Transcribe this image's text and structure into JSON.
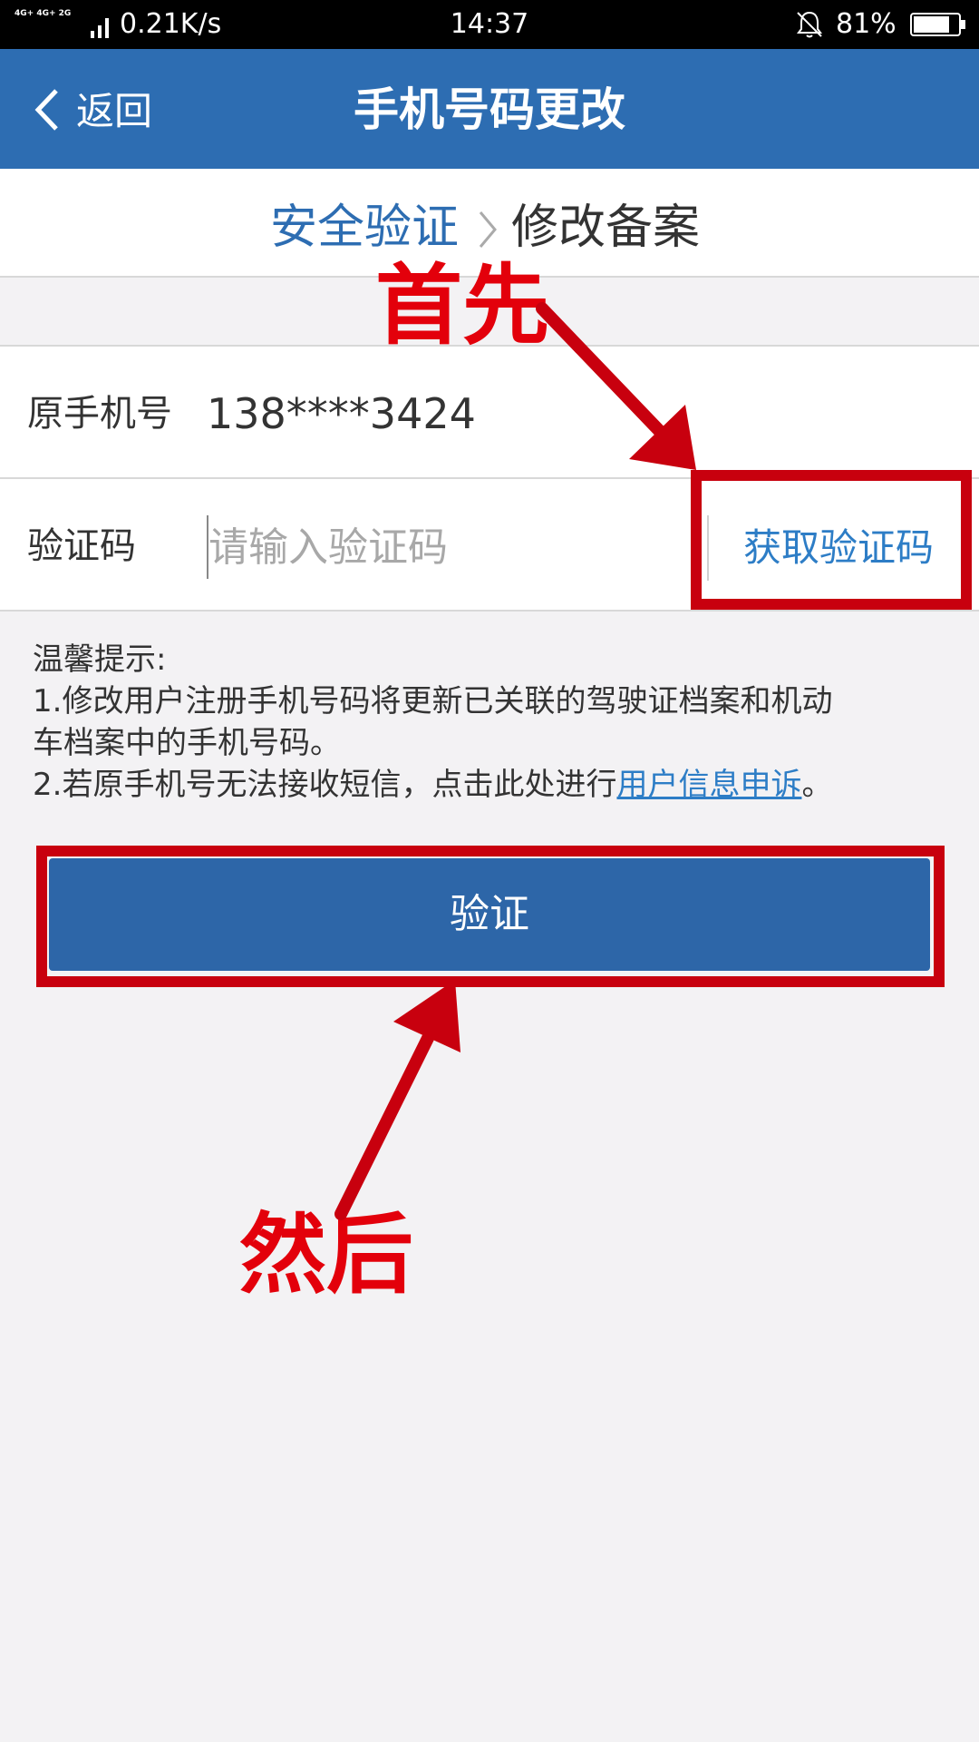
{
  "status_bar": {
    "network": "4G+ 4G+ 2G",
    "speed": "0.21K/s",
    "time": "14:37",
    "battery": "81%",
    "battery_level": 0.81
  },
  "nav": {
    "back_label": "返回",
    "title": "手机号码更改"
  },
  "steps": {
    "current": "安全验证",
    "next": "修改备案"
  },
  "form": {
    "phone_label": "原手机号",
    "phone_value": "138****3424",
    "code_label": "验证码",
    "code_placeholder": "请输入验证码",
    "get_code_label": "获取验证码"
  },
  "tips": {
    "title": "温馨提示:",
    "line1": "1.修改用户注册手机号码将更新已关联的驾驶证档案和机动",
    "line1_cont": "车档案中的手机号码。",
    "line2_prefix": "2.若原手机号无法接收短信，点击此处进行",
    "line2_link": "用户信息申诉",
    "line2_suffix": "。"
  },
  "verify_label": "验证",
  "annotations": {
    "first": "首先",
    "then": "然后",
    "color": "#e3000b"
  },
  "colors": {
    "primary": "#2d6db2",
    "link": "#2d7dc6",
    "annotation_stroke": "#c8000e"
  }
}
